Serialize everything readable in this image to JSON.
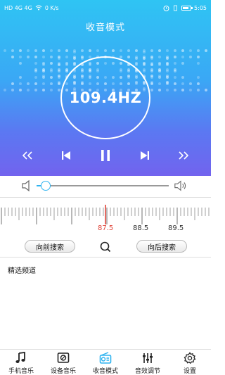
{
  "status_bar": {
    "left_text": "HD 4G 4G",
    "speed": "0 K/s",
    "time": "5:05"
  },
  "header": {
    "title": "收音模式",
    "frequency": "109.4HZ"
  },
  "colors": {
    "accent": "#2fb3f0",
    "tuner_marker": "#e0453a",
    "gradient_top": "#2fc4f3",
    "gradient_bottom": "#7263ee"
  },
  "player_controls": [
    {
      "name": "rewind-button",
      "icon": "double-chevron-left-icon"
    },
    {
      "name": "previous-button",
      "icon": "skip-previous-icon"
    },
    {
      "name": "pause-button",
      "icon": "pause-icon"
    },
    {
      "name": "next-button",
      "icon": "skip-next-icon"
    },
    {
      "name": "fast-forward-button",
      "icon": "double-chevron-right-icon"
    }
  ],
  "volume": {
    "level": 0.07
  },
  "tuner": {
    "labels": [
      "87.5",
      "88.5",
      "89.5"
    ],
    "active_label": "87.5"
  },
  "search": {
    "backward_label": "向前搜索",
    "forward_label": "向后搜索"
  },
  "section": {
    "favorites_label": "精选频道"
  },
  "bottom_nav": [
    {
      "label": "手机音乐",
      "icon": "music-note-icon"
    },
    {
      "label": "设备音乐",
      "icon": "device-music-icon"
    },
    {
      "label": "收音模式",
      "icon": "radio-icon",
      "active": true
    },
    {
      "label": "音效调节",
      "icon": "equalizer-icon"
    },
    {
      "label": "设置",
      "icon": "gear-icon"
    }
  ]
}
